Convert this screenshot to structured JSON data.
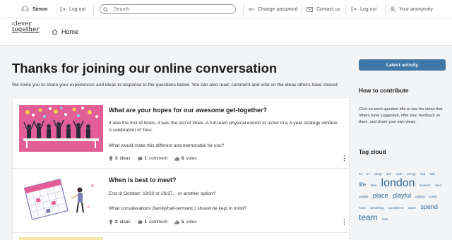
{
  "topbar": {
    "user_name": "Simon",
    "logout_left": "Log out",
    "search_placeholder": "Search",
    "change_password": "Change password",
    "contact_us": "Contact us",
    "logout_right": "Log out",
    "anonymity": "Your anonymity"
  },
  "brand": {
    "logo_line1": "clever",
    "logo_line2": "together",
    "home": "Home"
  },
  "main": {
    "title": "Thanks for joining our online conversation",
    "intro": "We invite you to share your experiences and ideas in response to the questions below. You can also read, comment and vote on the ideas others have shared."
  },
  "ideas": [
    {
      "title": "What are your hopes for our awesome get-together?",
      "text1": "It was the first of times, it was the last of times. A full-team physical events to usher in a 3-year strategy window. A celebration of Tess.",
      "text2": "What would make this different and memorable for you?",
      "ideas_count": "3",
      "ideas_label": "ideas",
      "comments_count": "1",
      "comments_label": "comment",
      "votes_count": "6",
      "votes_label": "votes",
      "image": "team-celebration-illustration"
    },
    {
      "title": "When is best to meet?",
      "text1": "End of October: 19/20 or 26/27... or another option?",
      "text2": "What considerations (family/half-term/etc.) should be kept in mind?",
      "ideas_count": "3",
      "ideas_label": "ideas",
      "comments_count": "1",
      "comments_label": "comment",
      "votes_count": "5",
      "votes_label": "votes",
      "image": "calendar-planning-illustration"
    }
  ],
  "sidebar": {
    "latest_activity": "Latest activity",
    "how_title": "How to contribute",
    "how_text": "Click on each question title to see the ideas that others have suggested, offer your feedback on them, and share your own views.",
    "tag_title": "Tag cloud",
    "tags": [
      {
        "text": "26",
        "size": 4.2
      },
      {
        "text": "27",
        "size": 4.2
      },
      {
        "text": "along",
        "size": 4.2
      },
      {
        "text": "due",
        "size": 4.2
      },
      {
        "text": "each",
        "size": 4.2
      },
      {
        "text": "energy",
        "size": 4.2
      },
      {
        "text": "had",
        "size": 4.2
      },
      {
        "text": "half",
        "size": 4.2
      },
      {
        "text": "life",
        "size": 8
      },
      {
        "text": "likes",
        "size": 4.2
      },
      {
        "text": "london",
        "size": 16
      },
      {
        "text": "moment",
        "size": 4.2
      },
      {
        "text": "need",
        "size": 4.2
      },
      {
        "text": "outside",
        "size": 4.2
      },
      {
        "text": "place",
        "size": 9
      },
      {
        "text": "playful",
        "size": 9
      },
      {
        "text": "playing",
        "size": 4.2
      },
      {
        "text": "pretty",
        "size": 4.2
      },
      {
        "text": "room",
        "size": 4.2
      },
      {
        "text": "something",
        "size": 4.2
      },
      {
        "text": "somewhere",
        "size": 4.2
      },
      {
        "text": "space",
        "size": 4.2
      },
      {
        "text": "spend",
        "size": 9
      },
      {
        "text": "team",
        "size": 12
      },
      {
        "text": "term",
        "size": 4.2
      }
    ]
  },
  "colors": {
    "accent": "#3f78a6",
    "tag_link": "#2f6a9b",
    "illustration_pink": "#e25e97"
  }
}
